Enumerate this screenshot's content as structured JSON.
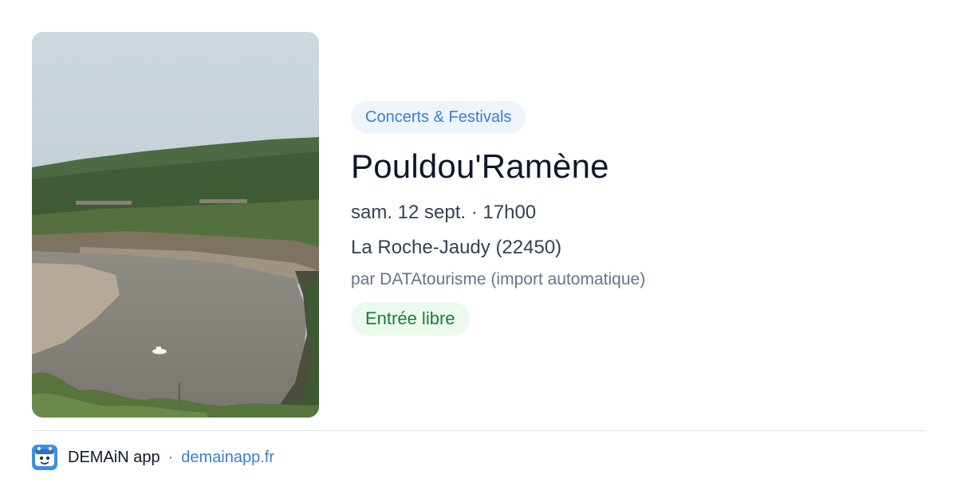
{
  "event": {
    "category": "Concerts & Festivals",
    "title": "Pouldou'Ramène",
    "datetime": "sam. 12 sept. · 17h00",
    "location": "La Roche-Jaudy (22450)",
    "organizer": "par DATAtourisme (import automatique)",
    "price": "Entrée libre"
  },
  "footer": {
    "app_name": "DEMAiN app",
    "separator": "·",
    "site": "demainapp.fr"
  },
  "colors": {
    "category_bg": "#eef4fc",
    "category_text": "#3b7fd1",
    "price_bg": "#ecfaee",
    "price_text": "#1d7a3a",
    "brand": "#3f8ee6"
  },
  "icons": {
    "logo": "demain-app-logo-icon"
  }
}
